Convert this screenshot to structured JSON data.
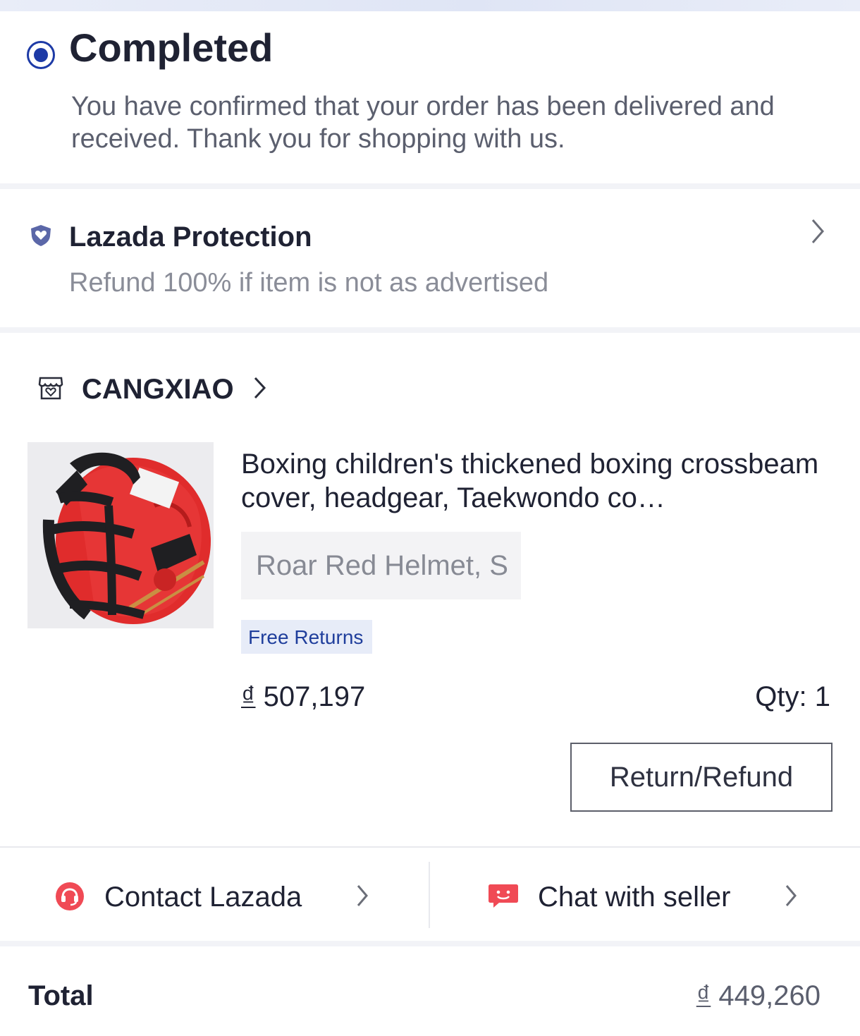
{
  "colors": {
    "accent_blue": "#1d3aa6",
    "protection_shield": "#5b67a8",
    "contact_red": "#f04a55",
    "free_returns_bg": "#e7ecf8",
    "free_returns_text": "#1f3e9c"
  },
  "status": {
    "title": "Completed",
    "description": "You have confirmed that your order has been delivered and received. Thank you for shopping with us."
  },
  "protection": {
    "title": "Lazada Protection",
    "subtitle": "Refund 100% if item is not as advertised",
    "icon": "shield-heart-icon"
  },
  "order": {
    "store_name": "CANGXIAO",
    "store_icon": "store-icon",
    "product": {
      "title": "Boxing children's thickened boxing crossbeam cover, headgear, Taekwondo co…",
      "variant": "Roar Red Helmet, S",
      "badge": "Free Returns",
      "currency": "₫",
      "price": "507,197",
      "qty_label": "Qty: 1"
    },
    "return_button": "Return/Refund",
    "contact_lazada": "Contact Lazada",
    "chat_with_seller": "Chat with seller"
  },
  "total": {
    "label": "Total",
    "currency": "₫",
    "value": "449,260"
  }
}
